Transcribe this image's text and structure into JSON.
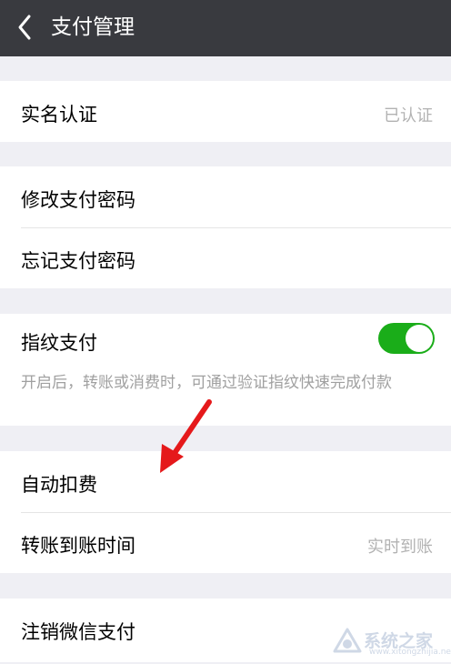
{
  "header": {
    "title": "支付管理"
  },
  "sections": {
    "identity": {
      "label": "实名认证",
      "value": "已认证"
    },
    "password": {
      "change_label": "修改支付密码",
      "forgot_label": "忘记支付密码"
    },
    "fingerprint": {
      "label": "指纹支付",
      "enabled": true,
      "description": "开启后，转账或消费时，可通过验证指纹快速完成付款"
    },
    "payments": {
      "auto_deduct_label": "自动扣费",
      "transfer_time_label": "转账到账时间",
      "transfer_time_value": "实时到账"
    },
    "account": {
      "cancel_label": "注销微信支付"
    }
  },
  "watermark": {
    "text": "系统之家",
    "url": "www.xitongzhijia.net"
  },
  "colors": {
    "topbar": "#393a3f",
    "background": "#efeff4",
    "toggle_on": "#1aad19",
    "annotation_arrow": "#e5191b"
  }
}
